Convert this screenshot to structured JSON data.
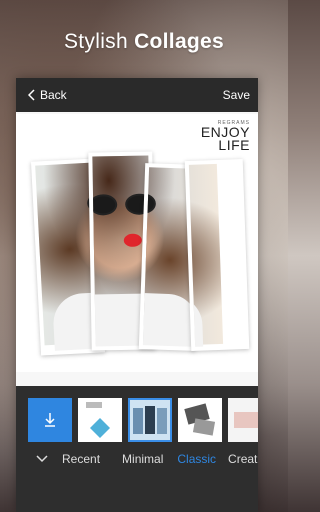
{
  "headline": {
    "light": "Stylish ",
    "bold": "Collages"
  },
  "topbar": {
    "back_label": "Back",
    "save_label": "Save"
  },
  "canvas": {
    "tagline_small": "REGRAMS",
    "tagline_line1": "ENJOY",
    "tagline_line2": "LIFE"
  },
  "tabs": [
    "Recent",
    "Minimal",
    "Classic",
    "Creative"
  ],
  "active_tab": "Classic",
  "colors": {
    "accent": "#2f86e0",
    "topbar": "#2a2a2a",
    "bottombar": "#2e2e2e"
  }
}
